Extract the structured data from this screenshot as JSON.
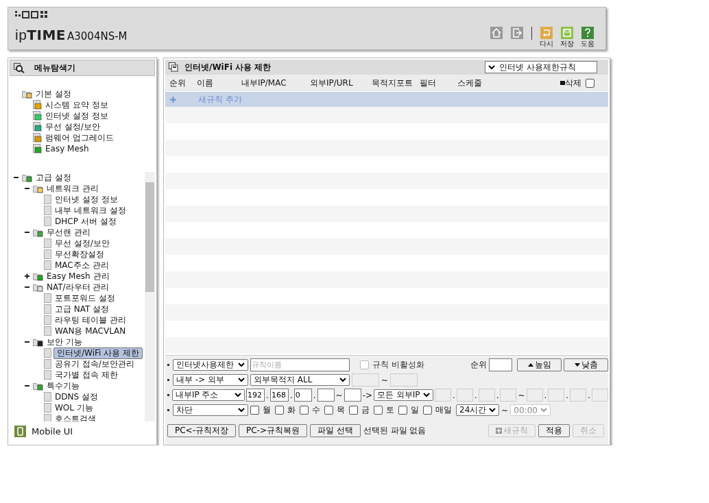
{
  "header": {
    "logo": "ip**TIME**",
    "model": "A3004NS-M",
    "tools": [
      {
        "kind": "home"
      },
      {
        "kind": "logout"
      },
      {
        "kind": "reload",
        "label": "다시"
      },
      {
        "kind": "save",
        "label": "저장"
      },
      {
        "kind": "help",
        "label": "도움"
      }
    ]
  },
  "sidebar": {
    "title": "메뉴탐색기",
    "basic": {
      "label": "기본 설정",
      "children": [
        {
          "label": "시스템 요약 정보",
          "selected": false
        },
        {
          "label": "인터넷 설정 정보",
          "selected": false
        },
        {
          "label": "무선 설정/보안",
          "selected": false
        },
        {
          "label": "펌웨어 업그레이드",
          "selected": false
        },
        {
          "label": "Easy Mesh",
          "selected": false
        }
      ]
    },
    "advanced": {
      "label": "고급 설정",
      "expanded": true,
      "children": [
        {
          "label": "네트워크 관리",
          "expanded": true,
          "children": [
            {
              "label": "인터넷 설정 정보",
              "selected": false
            },
            {
              "label": "내부 네트워크 설정",
              "selected": false
            },
            {
              "label": "DHCP 서버 설정",
              "selected": false
            }
          ]
        },
        {
          "label": "무선랜 관리",
          "expanded": true,
          "children": [
            {
              "label": "무선 설정/보안",
              "selected": false
            },
            {
              "label": "무선확장설정",
              "selected": false
            },
            {
              "label": "MAC주소 관리",
              "selected": false
            }
          ]
        },
        {
          "label": "Easy Mesh 관리",
          "expanded": false
        },
        {
          "label": "NAT/라우터 관리",
          "expanded": true,
          "children": [
            {
              "label": "포트포워드 설정",
              "selected": false
            },
            {
              "label": "고급 NAT 설정",
              "selected": false
            },
            {
              "label": "라우팅 테이블 관리",
              "selected": false
            },
            {
              "label": "WAN용 MACVLAN",
              "selected": false
            }
          ]
        },
        {
          "label": "보안 기능",
          "expanded": true,
          "children": [
            {
              "label": "인터넷/WiFi 사용 제한",
              "selected": true
            },
            {
              "label": "공유기 접속/보안관리",
              "selected": false
            },
            {
              "label": "국가별 접속 제한",
              "selected": false
            }
          ]
        },
        {
          "label": "특수기능",
          "expanded": true,
          "children": [
            {
              "label": "DDNS 설정",
              "selected": false
            },
            {
              "label": "WOL 기능",
              "selected": false
            },
            {
              "label": "호스트검색",
              "selected": false
            }
          ]
        }
      ]
    },
    "footer": "Mobile UI"
  },
  "main": {
    "title": "인터넷/WiFi 사용 제한",
    "rule_select": "인터넷 사용제한규칙",
    "columns": [
      "순위",
      "이름",
      "내부IP/MAC",
      "외부IP/URL",
      "목적지포트",
      "필터",
      "스케줄"
    ],
    "delete": {
      "label": "삭제",
      "checked": false
    },
    "add_row": "새규칙 추가",
    "form": [
      [
        {
          "kind": "select",
          "value": "인터넷사용제한"
        },
        {
          "kind": "input",
          "placeholder": "규칙이름"
        },
        {
          "kind": "checkbox",
          "label": "규칙 비활성화",
          "checked": false,
          "disabled": true
        },
        {
          "kind": "spacer"
        },
        {
          "kind": "text",
          "text": "순위"
        },
        {
          "kind": "input"
        },
        {
          "kind": "raise-button",
          "label": "높임"
        },
        {
          "kind": "lower-button",
          "label": "낮춤"
        }
      ],
      [
        {
          "kind": "select",
          "value": "내부 -> 외부"
        },
        {
          "kind": "select",
          "value": "외부목적지 ALL"
        },
        {
          "kind": "input",
          "disabled": true
        },
        {
          "kind": "text",
          "text": "~"
        },
        {
          "kind": "input",
          "disabled": true
        }
      ],
      [
        {
          "kind": "select",
          "value": "내부IP 주소"
        },
        {
          "kind": "input",
          "value": "192"
        },
        {
          "kind": "text",
          "text": "."
        },
        {
          "kind": "input",
          "value": "168"
        },
        {
          "kind": "text",
          "text": "."
        },
        {
          "kind": "input",
          "value": "0"
        },
        {
          "kind": "text",
          "text": "."
        },
        {
          "kind": "input"
        },
        {
          "kind": "text",
          "text": "~"
        },
        {
          "kind": "input"
        },
        {
          "kind": "text",
          "text": "->"
        },
        {
          "kind": "select",
          "value": "모든 외부IP"
        },
        {
          "kind": "input",
          "disabled": true
        },
        {
          "kind": "text",
          "text": "."
        },
        {
          "kind": "input",
          "disabled": true
        },
        {
          "kind": "text",
          "text": "."
        },
        {
          "kind": "input",
          "disabled": true
        },
        {
          "kind": "text",
          "text": "."
        },
        {
          "kind": "input",
          "disabled": true
        },
        {
          "kind": "text",
          "text": "~"
        },
        {
          "kind": "input",
          "disabled": true
        },
        {
          "kind": "text",
          "text": "."
        },
        {
          "kind": "input",
          "disabled": true
        },
        {
          "kind": "text",
          "text": "."
        },
        {
          "kind": "input",
          "disabled": true
        },
        {
          "kind": "text",
          "text": "."
        },
        {
          "kind": "input",
          "disabled": true
        }
      ],
      [
        {
          "kind": "select",
          "value": "차단"
        },
        {
          "kind": "checkbox",
          "label": "월",
          "checked": false
        },
        {
          "kind": "checkbox",
          "label": "화",
          "checked": false
        },
        {
          "kind": "checkbox",
          "label": "수",
          "checked": false
        },
        {
          "kind": "checkbox",
          "label": "목",
          "checked": false
        },
        {
          "kind": "checkbox",
          "label": "금",
          "checked": false
        },
        {
          "kind": "checkbox",
          "label": "토",
          "checked": false
        },
        {
          "kind": "checkbox",
          "label": "일",
          "checked": false
        },
        {
          "kind": "checkbox",
          "label": "매일",
          "checked": false
        },
        {
          "kind": "select",
          "value": "24시간"
        },
        {
          "kind": "text",
          "text": "~"
        },
        {
          "kind": "select",
          "value": "00:00",
          "disabled": true
        }
      ]
    ],
    "actions": [
      {
        "kind": "button",
        "label": "PC<-규칙저장"
      },
      {
        "kind": "button",
        "label": "PC->규칙복원"
      },
      {
        "kind": "button",
        "label": "파일 선택"
      },
      {
        "kind": "text",
        "text": "선택된 파일 없음"
      },
      {
        "kind": "spacer"
      },
      {
        "kind": "add-button",
        "label": "새규칙",
        "disabled": true
      },
      {
        "kind": "button",
        "label": "적용"
      },
      {
        "kind": "button",
        "label": "취소",
        "disabled": true
      }
    ]
  }
}
